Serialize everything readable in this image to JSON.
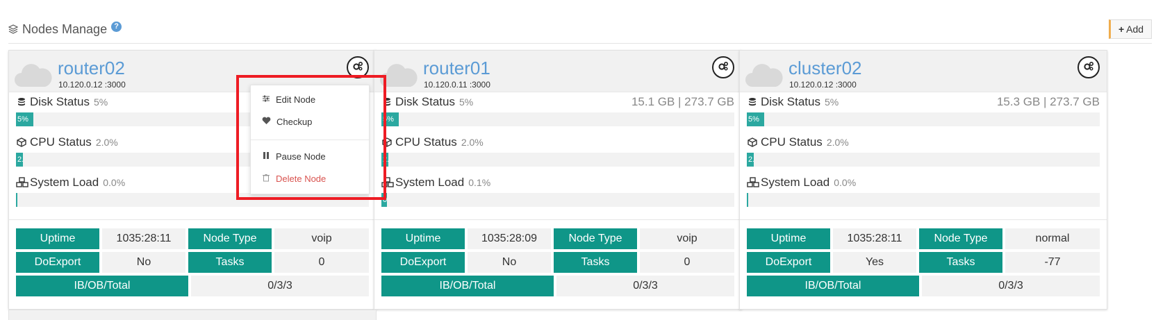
{
  "header": {
    "title": "Nodes Manage",
    "help": "?"
  },
  "add_button": {
    "label": "Add",
    "icon": "plus-icon"
  },
  "colors": {
    "teal": "#0f9688",
    "bar": "#2ba8a0",
    "name": "#5b9bd5",
    "danger": "#d9534f",
    "highlight": "#ee1c24"
  },
  "labels": {
    "disk": "Disk Status",
    "cpu": "CPU Status",
    "load": "System Load",
    "uptime": "Uptime",
    "node_type": "Node Type",
    "doexport": "DoExport",
    "tasks": "Tasks",
    "iobt": "IB/OB/Total"
  },
  "nodes": [
    {
      "name": "router02",
      "addr": "10.120.0.12 :3000",
      "disk_pct": "5%",
      "disk_fill": 5,
      "disk_size": "",
      "cpu_pct": "2.0%",
      "cpu_fill": 2,
      "load_pct": "0.0%",
      "load_fill": 0,
      "uptime": "1035:28:11",
      "node_type": "voip",
      "doexport": "No",
      "tasks": "0",
      "iobt": "0/3/3"
    },
    {
      "name": "router01",
      "addr": "10.120.0.11 :3000",
      "disk_pct": "5%",
      "disk_fill": 5,
      "disk_size": "15.1 GB | 273.7 GB",
      "cpu_pct": "2.0%",
      "cpu_fill": 2,
      "load_pct": "0.1%",
      "load_fill": 0.1,
      "uptime": "1035:28:09",
      "node_type": "voip",
      "doexport": "No",
      "tasks": "0",
      "iobt": "0/3/3"
    },
    {
      "name": "cluster02",
      "addr": "10.120.0.12 :3000",
      "disk_pct": "5%",
      "disk_fill": 5,
      "disk_size": "15.3 GB | 273.7 GB",
      "cpu_pct": "2.0%",
      "cpu_fill": 2,
      "load_pct": "0.0%",
      "load_fill": 0,
      "uptime": "1035:28:11",
      "node_type": "normal",
      "doexport": "Yes",
      "tasks": "-77",
      "iobt": "0/3/3"
    }
  ],
  "menu": {
    "edit": "Edit Node",
    "checkup": "Checkup",
    "pause": "Pause Node",
    "delete": "Delete Node"
  }
}
